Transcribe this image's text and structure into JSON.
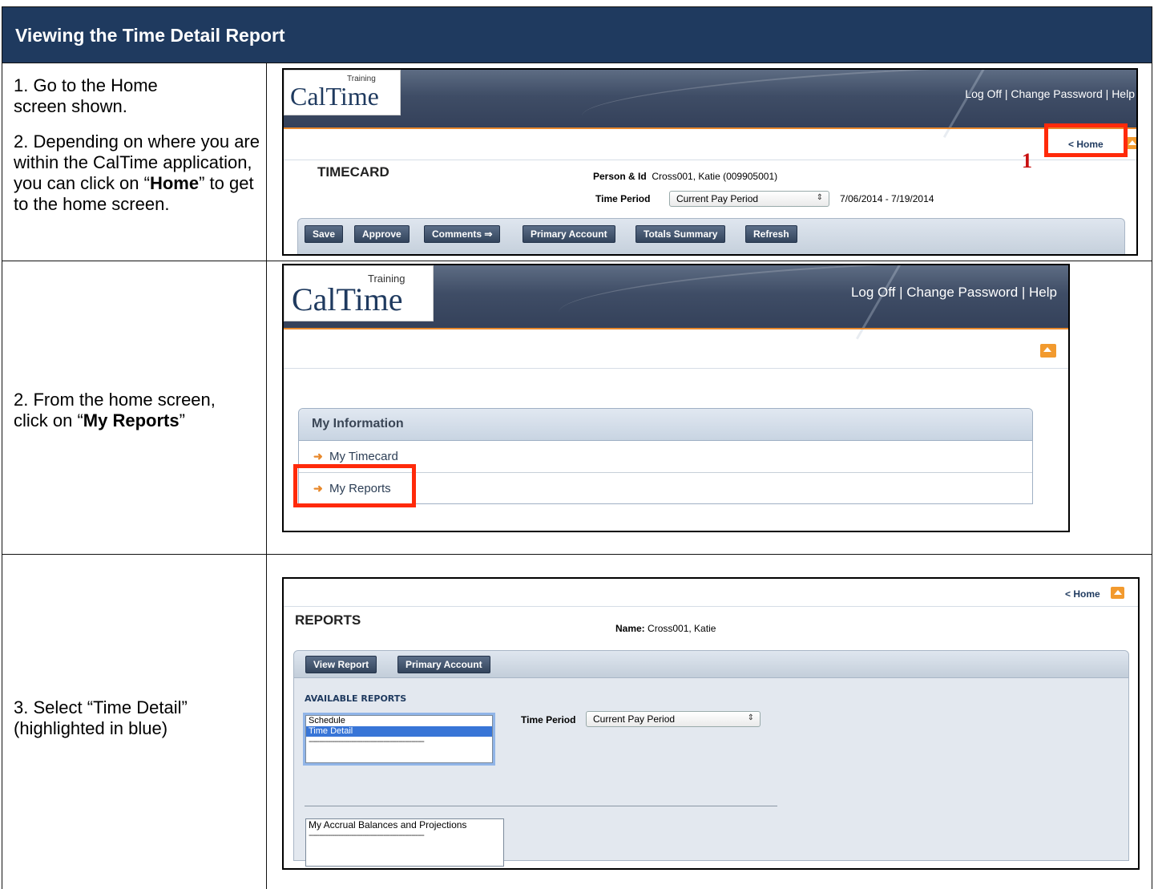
{
  "document": {
    "title": "Viewing the Time Detail Report"
  },
  "steps": [
    {
      "lines": [
        "1. Go to the Home",
        "screen shown."
      ],
      "sub_pre": "2.  Depending on where you are within the CalTime application, you can click on “",
      "sub_bold": "Home",
      "sub_post": "” to get to the home screen."
    },
    {
      "pre": "2. From the home screen, click on “",
      "bold": "My Reports",
      "post": "”"
    },
    {
      "text": "3.  Select “Time Detail” (highlighted in blue)"
    }
  ],
  "app": {
    "logo_word": "CalTime",
    "logo_training": "Training",
    "top_links": "Log Off | Change Password | Help",
    "home_link": "< Home",
    "callout_number": "1"
  },
  "timecard": {
    "title": "TIMECARD",
    "person_label": "Person & Id",
    "person_value": "Cross001, Katie (009905001)",
    "period_label": "Time Period",
    "period_value": "Current Pay Period",
    "period_range": "7/06/2014 - 7/19/2014",
    "buttons": [
      "Save",
      "Approve",
      "Comments ⇒",
      "Primary Account",
      "Totals Summary",
      "Refresh"
    ]
  },
  "home": {
    "panel_title": "My Information",
    "items": [
      "My Timecard",
      "My Reports"
    ]
  },
  "reports": {
    "title": "REPORTS",
    "name_label": "Name:",
    "name_value": "Cross001, Katie",
    "buttons": [
      "View Report",
      "Primary Account"
    ],
    "section_title": "AVAILABLE REPORTS",
    "list1": [
      "Schedule",
      "Time Detail",
      "------------------------------------------------------"
    ],
    "list1_selected": "Time Detail",
    "period_label": "Time Period",
    "period_value": "Current Pay Period",
    "list2": [
      "My Accrual Balances and Projections",
      "------------------------------------------------------"
    ]
  }
}
